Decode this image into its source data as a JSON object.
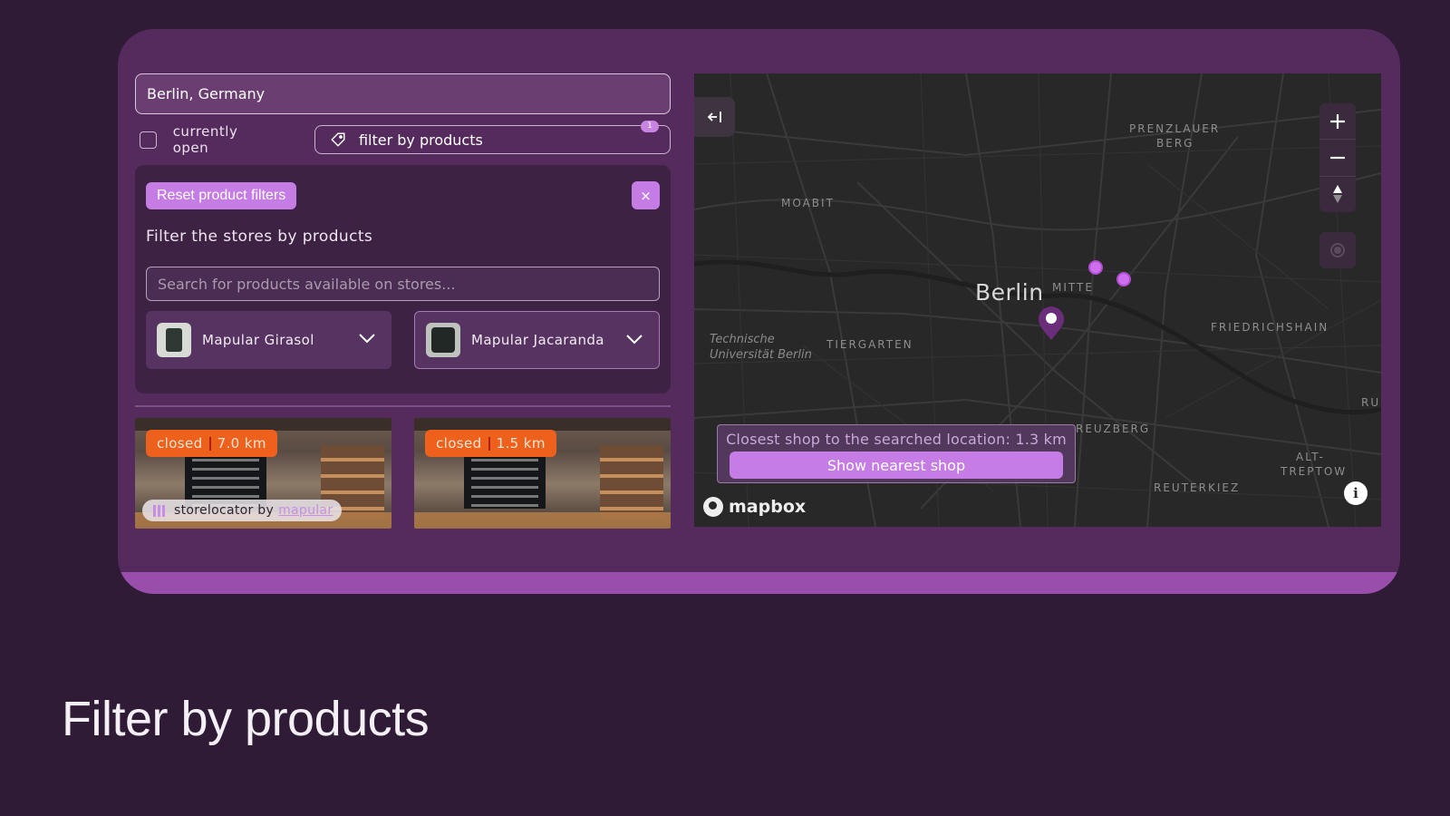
{
  "search": {
    "value": "Berlin, Germany"
  },
  "filters": {
    "currently_open_label": "currently open",
    "filter_by_products_label": "filter by products",
    "filter_count": "1"
  },
  "product_filter": {
    "reset_label": "Reset product filters",
    "close_label": "×",
    "title": "Filter the stores by products",
    "search_placeholder": "Search for products available on stores...",
    "products": [
      {
        "label": "Mapular Girasol"
      },
      {
        "label": "Mapular Jacaranda"
      }
    ]
  },
  "stores": [
    {
      "status": "closed",
      "distance": "7.0 km"
    },
    {
      "status": "closed",
      "distance": "1.5 km"
    }
  ],
  "branding": {
    "prefix": "storelocator by",
    "link": "mapular"
  },
  "map": {
    "collapse_icon": "collapse-left-icon",
    "city": "Berlin",
    "labels": [
      "PRENZLAUER",
      "BERG",
      "MOABIT",
      "MITTE",
      "FRIEDRICHSHAIN",
      "TIERGARTEN",
      "RU",
      "REUZBERG",
      "ALT-",
      "TREPTOW",
      "REUTERKIEZ"
    ],
    "university": [
      "Technische",
      "Universität Berlin"
    ],
    "zoom_in": "+",
    "zoom_out": "−",
    "nearest_message": "Closest shop to the searched location: 1.3 km",
    "show_nearest_label": "Show nearest shop",
    "mapbox_label": "mapbox",
    "info_label": "i"
  },
  "colors": {
    "background": "#2f1b36",
    "frame": "#552a5d",
    "accent": "#c57ce5",
    "closed_badge": "#ee611c",
    "map_bg": "#282828"
  },
  "caption": "Filter by products"
}
